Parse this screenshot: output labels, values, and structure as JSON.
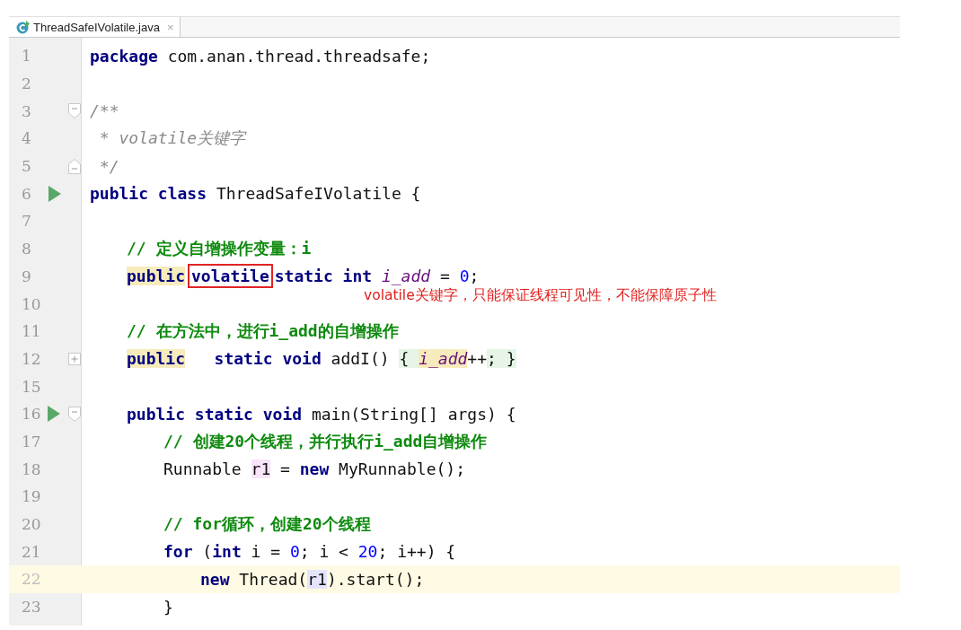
{
  "tabs": [
    {
      "label": "ThreadSafeIVolatile.java",
      "close": "×",
      "selected": true
    }
  ],
  "lines": [
    {
      "number": "1",
      "tokens": [
        {
          "kind": "kw",
          "text": "package"
        },
        {
          "kind": "plain",
          "text": " com.anan.thread.threadsafe;"
        }
      ]
    },
    {
      "number": "2"
    },
    {
      "number": "3",
      "fold_start": true,
      "tokens": [
        {
          "kind": "doc",
          "text": "/**"
        }
      ]
    },
    {
      "number": "4",
      "tokens": [
        {
          "kind": "doc",
          "text": " * volatile关键字"
        }
      ]
    },
    {
      "number": "5",
      "fold_end": true,
      "tokens": [
        {
          "kind": "doc",
          "text": " */"
        }
      ]
    },
    {
      "number": "6",
      "run": true,
      "tokens": [
        {
          "kind": "kw",
          "text": "public class"
        },
        {
          "kind": "plain",
          "text": " ThreadSafeIVolatile {"
        }
      ],
      "children": [
        {
          "number": "7"
        },
        {
          "number": "8",
          "tokens": [
            {
              "kind": "comment",
              "text": "// 定义自增操作变量：i"
            }
          ]
        },
        {
          "number": "9",
          "tokens": [
            {
              "kind": "kw",
              "text": "public",
              "color": "#f6ebbc"
            },
            {
              "kind": "kw",
              "text": "volatile",
              "boxed": true
            },
            {
              "kind": "kw",
              "text": "static int"
            },
            {
              "kind": "field",
              "text": " i_add"
            },
            {
              "kind": "plain",
              "text": " = "
            },
            {
              "kind": "num",
              "text": "0"
            },
            {
              "kind": "plain",
              "text": ";"
            }
          ]
        },
        {
          "number": "10",
          "note": "volatile关键字，只能保证线程可见性，不能保障原子性"
        },
        {
          "number": "11",
          "tokens": [
            {
              "kind": "comment",
              "text": "// 在方法中，进行i_add的自增操作"
            }
          ]
        },
        {
          "number": "12",
          "collapsed": true,
          "tokens": [
            {
              "kind": "kw",
              "text": "public",
              "color": "#f6ebbc"
            },
            {
              "kind": "kw",
              "text": "   static void"
            },
            {
              "kind": "plain",
              "text": " addI() "
            },
            {
              "kind": "plain",
              "text": "{ ",
              "color": "#e6f5e6"
            },
            {
              "kind": "field",
              "text": "i_add",
              "color": "#f6ebbc"
            },
            {
              "kind": "plain",
              "text": "++"
            },
            {
              "kind": "plain",
              "text": "; }",
              "color": "#e6f5e6"
            }
          ]
        },
        {
          "number": "15"
        },
        {
          "number": "16",
          "run": true,
          "fold_start": true,
          "tokens": [
            {
              "kind": "kw",
              "text": "public static void"
            },
            {
              "kind": "plain",
              "text": " main(String[] args) {"
            }
          ],
          "children": [
            {
              "number": "17",
              "tokens": [
                {
                  "kind": "comment",
                  "text": "// 创建20个线程，并行执行i_add自增操作"
                }
              ]
            },
            {
              "number": "18",
              "tokens": [
                {
                  "kind": "plain",
                  "text": "Runnable "
                },
                {
                  "kind": "plain",
                  "text": "r1",
                  "color": "#f9e4f9"
                },
                {
                  "kind": "plain",
                  "text": " = "
                },
                {
                  "kind": "kw",
                  "text": "new"
                },
                {
                  "kind": "plain",
                  "text": " MyRunnable();"
                }
              ]
            },
            {
              "number": "19"
            },
            {
              "number": "20",
              "tokens": [
                {
                  "kind": "comment",
                  "text": "// for循环，创建20个线程"
                }
              ]
            },
            {
              "number": "21",
              "tokens": [
                {
                  "kind": "kw",
                  "text": "for"
                },
                {
                  "kind": "plain",
                  "text": " ("
                },
                {
                  "kind": "kw",
                  "text": "int"
                },
                {
                  "kind": "plain",
                  "text": " i = "
                },
                {
                  "kind": "num",
                  "text": "0"
                },
                {
                  "kind": "plain",
                  "text": "; i < "
                },
                {
                  "kind": "num",
                  "text": "20"
                },
                {
                  "kind": "plain",
                  "text": "; i++) {"
                }
              ],
              "children": [
                {
                  "number": "22",
                  "current": true,
                  "tokens": [
                    {
                      "kind": "kw",
                      "text": "new"
                    },
                    {
                      "kind": "plain",
                      "text": " Thread("
                    },
                    {
                      "kind": "plain",
                      "text": "r1",
                      "color": "#e4e4ff"
                    },
                    {
                      "kind": "plain",
                      "text": ").start();"
                    }
                  ]
                }
              ]
            },
            {
              "number": "23",
              "tokens": [
                {
                  "kind": "plain",
                  "text": "}"
                }
              ]
            }
          ]
        }
      ]
    }
  ]
}
